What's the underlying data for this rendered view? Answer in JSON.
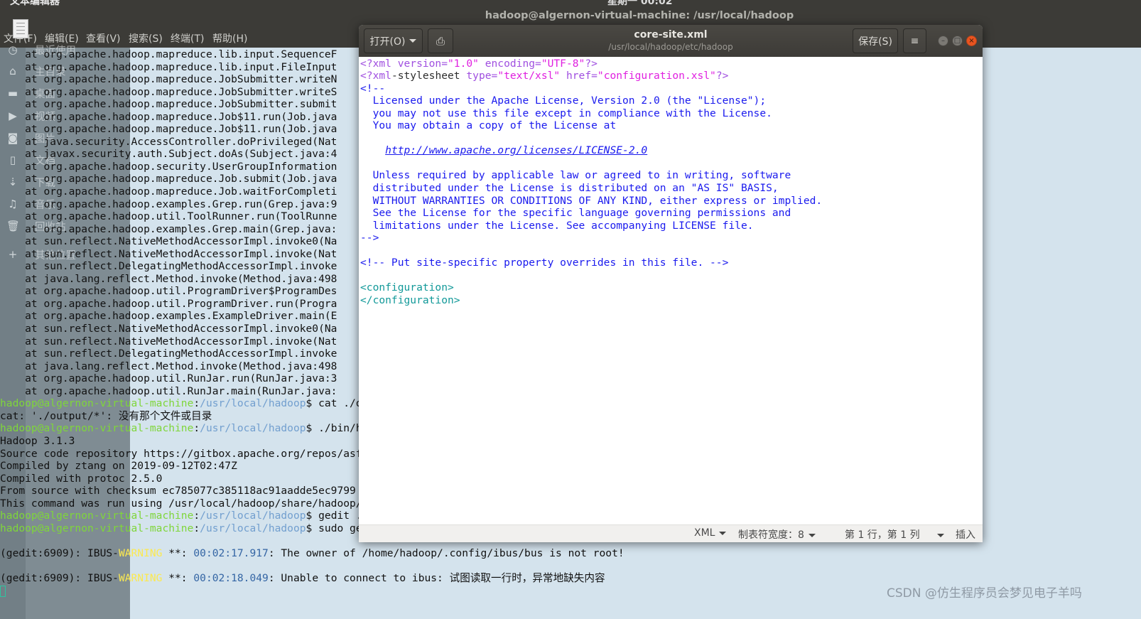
{
  "topbar": {
    "app_name": "文本编辑器",
    "clock": "星期一 00:02",
    "terminal_title": "hadoop@algernon-virtual-machine: /usr/local/hadoop"
  },
  "menubar": [
    "文件(F)",
    "编辑(E)",
    "查看(V)",
    "搜索(S)",
    "终端(T)",
    "帮助(H)"
  ],
  "sidebar": [
    {
      "icon": "clock-icon",
      "label": "最近使用"
    },
    {
      "icon": "home-icon",
      "label": "主目录"
    },
    {
      "icon": "folder-icon",
      "label": "桌面"
    },
    {
      "icon": "video-icon",
      "label": "视频"
    },
    {
      "icon": "camera-icon",
      "label": "图片"
    },
    {
      "icon": "document-icon",
      "label": "文档"
    },
    {
      "icon": "download-icon",
      "label": "下载"
    },
    {
      "icon": "music-icon",
      "label": "音乐"
    },
    {
      "icon": "trash-icon",
      "label": "回收站"
    },
    {
      "icon": "plus-icon",
      "label": "其他位置"
    }
  ],
  "colors": {
    "prompt_user": "#7fd63a",
    "prompt_path": "#729fcf",
    "warning": "#fce94f",
    "timestamp": "#3465a4",
    "xml_decl": "#a04fe0",
    "xml_string": "#e020e0",
    "comment": "#1a1aee",
    "tag": "#129999"
  },
  "terminal_lines": [
    [
      {
        "t": "    at org.apache.hadoop.mapreduce.lib.input.SequenceF"
      }
    ],
    [
      {
        "t": "    at org.apache.hadoop.mapreduce.lib.input.FileInput"
      }
    ],
    [
      {
        "t": "    at org.apache.hadoop.mapreduce.JobSubmitter.writeN"
      }
    ],
    [
      {
        "t": "    at org.apache.hadoop.mapreduce.JobSubmitter.writeS"
      }
    ],
    [
      {
        "t": "    at org.apache.hadoop.mapreduce.JobSubmitter.submit"
      }
    ],
    [
      {
        "t": "    at org.apache.hadoop.mapreduce.Job$11.run(Job.java"
      }
    ],
    [
      {
        "t": "    at org.apache.hadoop.mapreduce.Job$11.run(Job.java"
      }
    ],
    [
      {
        "t": "    at java.security.AccessController.doPrivileged(Nat"
      }
    ],
    [
      {
        "t": "    at javax.security.auth.Subject.doAs(Subject.java:4"
      }
    ],
    [
      {
        "t": "    at org.apache.hadoop.security.UserGroupInformation"
      }
    ],
    [
      {
        "t": "    at org.apache.hadoop.mapreduce.Job.submit(Job.java"
      }
    ],
    [
      {
        "t": "    at org.apache.hadoop.mapreduce.Job.waitForCompleti"
      }
    ],
    [
      {
        "t": "    at org.apache.hadoop.examples.Grep.run(Grep.java:9"
      }
    ],
    [
      {
        "t": "    at org.apache.hadoop.util.ToolRunner.run(ToolRunne"
      }
    ],
    [
      {
        "t": "    at org.apache.hadoop.examples.Grep.main(Grep.java:"
      }
    ],
    [
      {
        "t": "    at sun.reflect.NativeMethodAccessorImpl.invoke0(Na"
      }
    ],
    [
      {
        "t": "    at sun.reflect.NativeMethodAccessorImpl.invoke(Nat"
      }
    ],
    [
      {
        "t": "    at sun.reflect.DelegatingMethodAccessorImpl.invoke"
      }
    ],
    [
      {
        "t": "    at java.lang.reflect.Method.invoke(Method.java:498"
      }
    ],
    [
      {
        "t": "    at org.apache.hadoop.util.ProgramDriver$ProgramDes"
      }
    ],
    [
      {
        "t": "    at org.apache.hadoop.util.ProgramDriver.run(Progra"
      }
    ],
    [
      {
        "t": "    at org.apache.hadoop.examples.ExampleDriver.main(E"
      }
    ],
    [
      {
        "t": "    at sun.reflect.NativeMethodAccessorImpl.invoke0(Na"
      }
    ],
    [
      {
        "t": "    at sun.reflect.NativeMethodAccessorImpl.invoke(Nat"
      }
    ],
    [
      {
        "t": "    at sun.reflect.DelegatingMethodAccessorImpl.invoke"
      }
    ],
    [
      {
        "t": "    at java.lang.reflect.Method.invoke(Method.java:498"
      }
    ],
    [
      {
        "t": "    at org.apache.hadoop.util.RunJar.run(RunJar.java:3"
      }
    ],
    [
      {
        "t": "    at org.apache.hadoop.util.RunJar.main(RunJar.java:"
      }
    ],
    [
      {
        "t": "hadoop@algernon-virtual-machine",
        "c": "prompt_user"
      },
      {
        "t": ":"
      },
      {
        "t": "/usr/local/hadoop",
        "c": "prompt_path"
      },
      {
        "t": "$ cat ./o"
      }
    ],
    [
      {
        "t": "cat: './output/*': 没有那个文件或目录"
      }
    ],
    [
      {
        "t": "hadoop@algernon-virtual-machine",
        "c": "prompt_user"
      },
      {
        "t": ":"
      },
      {
        "t": "/usr/local/hadoop",
        "c": "prompt_path"
      },
      {
        "t": "$ ./bin/h"
      }
    ],
    [
      {
        "t": "Hadoop 3.1.3"
      }
    ],
    [
      {
        "t": "Source code repository https://gitbox.apache.org/repos/asf"
      }
    ],
    [
      {
        "t": "Compiled by ztang on 2019-09-12T02:47Z"
      }
    ],
    [
      {
        "t": "Compiled with protoc 2.5.0"
      }
    ],
    [
      {
        "t": "From source with checksum ec785077c385118ac91aadde5ec9799"
      }
    ],
    [
      {
        "t": "This command was run using /usr/local/hadoop/share/hadoop/"
      }
    ],
    [
      {
        "t": "hadoop@algernon-virtual-machine",
        "c": "prompt_user"
      },
      {
        "t": ":"
      },
      {
        "t": "/usr/local/hadoop",
        "c": "prompt_path"
      },
      {
        "t": "$ gedit ."
      }
    ],
    [
      {
        "t": "hadoop@algernon-virtual-machine",
        "c": "prompt_user"
      },
      {
        "t": ":"
      },
      {
        "t": "/usr/local/hadoop",
        "c": "prompt_path"
      },
      {
        "t": "$ sudo ge"
      }
    ],
    [
      {
        "t": ""
      }
    ],
    [
      {
        "t": "(gedit:6909): IBUS-"
      },
      {
        "t": "WARNING",
        "c": "warning"
      },
      {
        "t": " **: "
      },
      {
        "t": "00:02:17.917",
        "c": "timestamp"
      },
      {
        "t": ": The owner of /home/hadoop/.config/ibus/bus is not root!"
      }
    ],
    [
      {
        "t": ""
      }
    ],
    [
      {
        "t": "(gedit:6909): IBUS-"
      },
      {
        "t": "WARNING",
        "c": "warning"
      },
      {
        "t": " **: "
      },
      {
        "t": "00:02:18.049",
        "c": "timestamp"
      },
      {
        "t": ": Unable to connect to ibus: 试图读取一行时，异常地缺失内容"
      }
    ]
  ],
  "gedit": {
    "open_label": "打开(O)",
    "title": "core-site.xml",
    "path": "/usr/local/hadoop/etc/hadoop",
    "save_label": "保存(S)",
    "lines": [
      [
        {
          "t": "<?xml ",
          "c": "xml_decl"
        },
        {
          "t": "version=",
          "c": "xml_decl"
        },
        {
          "t": "\"1.0\"",
          "c": "xml_string"
        },
        {
          "t": " encoding=",
          "c": "xml_decl"
        },
        {
          "t": "\"UTF-8\"",
          "c": "xml_string"
        },
        {
          "t": "?>",
          "c": "xml_decl"
        }
      ],
      [
        {
          "t": "<?xml",
          "c": "xml_decl"
        },
        {
          "t": "-stylesheet "
        },
        {
          "t": "type=",
          "c": "xml_decl"
        },
        {
          "t": "\"text/xsl\"",
          "c": "xml_string"
        },
        {
          "t": " href=",
          "c": "xml_decl"
        },
        {
          "t": "\"configuration.xsl\"",
          "c": "xml_string"
        },
        {
          "t": "?>",
          "c": "xml_decl"
        }
      ],
      [
        {
          "t": "<!--",
          "c": "comment"
        }
      ],
      [
        {
          "t": "  Licensed under the Apache License, Version 2.0 (the \"License\");",
          "c": "comment"
        }
      ],
      [
        {
          "t": "  you may not use this file except in compliance with the License.",
          "c": "comment"
        }
      ],
      [
        {
          "t": "  You may obtain a copy of the License at",
          "c": "comment"
        }
      ],
      [
        {
          "t": ""
        }
      ],
      [
        {
          "t": "    "
        },
        {
          "t": "http://www.apache.org/licenses/LICENSE-2.0",
          "c": "comment",
          "link": true
        }
      ],
      [
        {
          "t": ""
        }
      ],
      [
        {
          "t": "  Unless required by applicable law or agreed to in writing, software",
          "c": "comment"
        }
      ],
      [
        {
          "t": "  distributed under the License is distributed on an \"AS IS\" BASIS,",
          "c": "comment"
        }
      ],
      [
        {
          "t": "  WITHOUT WARRANTIES OR CONDITIONS OF ANY KIND, either express or implied.",
          "c": "comment"
        }
      ],
      [
        {
          "t": "  See the License for the specific language governing permissions and",
          "c": "comment"
        }
      ],
      [
        {
          "t": "  limitations under the License. See accompanying LICENSE file.",
          "c": "comment"
        }
      ],
      [
        {
          "t": "-->",
          "c": "comment"
        }
      ],
      [
        {
          "t": ""
        }
      ],
      [
        {
          "t": "<!-- Put site-specific property overrides in this file. -->",
          "c": "comment"
        }
      ],
      [
        {
          "t": ""
        }
      ],
      [
        {
          "t": "<configuration>",
          "c": "tag"
        }
      ],
      [
        {
          "t": "</configuration>",
          "c": "tag"
        }
      ]
    ],
    "status": {
      "language": "XML",
      "tab_width": "制表符宽度：8",
      "position": "第 1 行，第 1 列",
      "mode": "插入"
    }
  },
  "watermark": "CSDN @仿生程序员会梦见电子羊吗"
}
